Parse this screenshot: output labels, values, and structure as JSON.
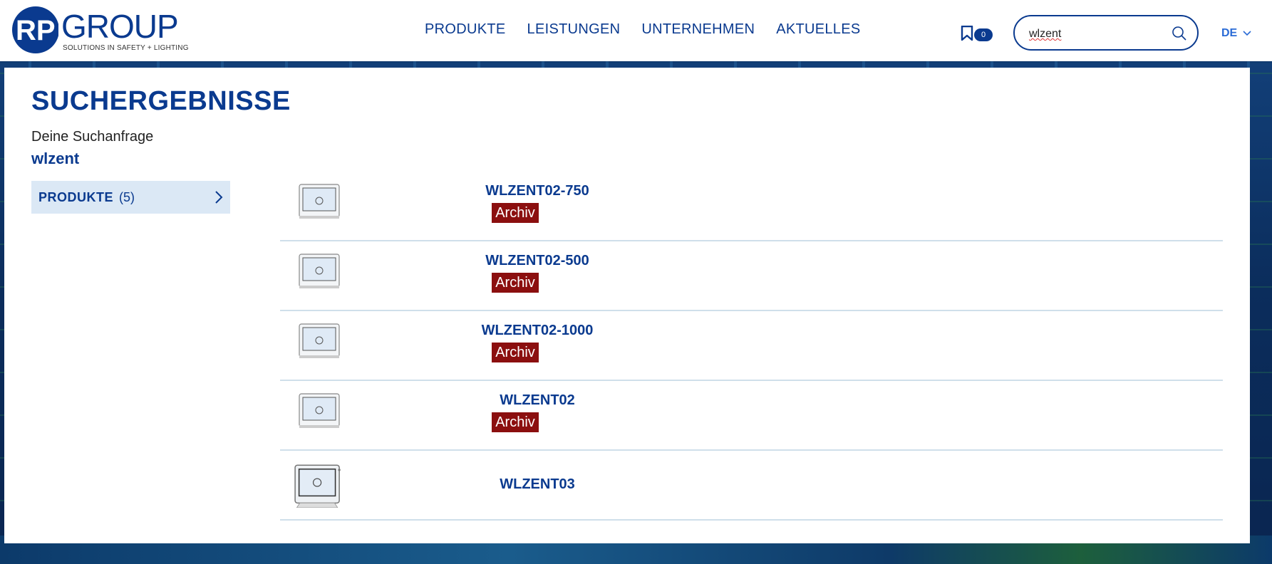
{
  "header": {
    "logo": {
      "mark": "RP",
      "name": "GROUP",
      "tagline": "SOLUTIONS IN SAFETY + LIGHTING"
    },
    "nav": [
      "PRODUKTE",
      "LEISTUNGEN",
      "UNTERNEHMEN",
      "AKTUELLES"
    ],
    "bookmark_count": "0",
    "search_value": "wlzent",
    "language": "DE"
  },
  "main": {
    "title": "SUCHERGEBNISSE",
    "query_label": "Deine Suchanfrage",
    "query_value": "wlzent",
    "filter": {
      "label": "PRODUKTE",
      "count": "(5)"
    },
    "results": [
      {
        "name": "WLZENT02-750",
        "badge": "Archiv"
      },
      {
        "name": "WLZENT02-500",
        "badge": "Archiv"
      },
      {
        "name": "WLZENT02-1000",
        "badge": "Archiv"
      },
      {
        "name": "WLZENT02",
        "badge": "Archiv"
      },
      {
        "name": "WLZENT03",
        "badge": ""
      }
    ]
  },
  "colors": {
    "brand": "#0a3a8f",
    "archiv": "#8b0f0f",
    "filter_bg": "#dbe8f5"
  }
}
